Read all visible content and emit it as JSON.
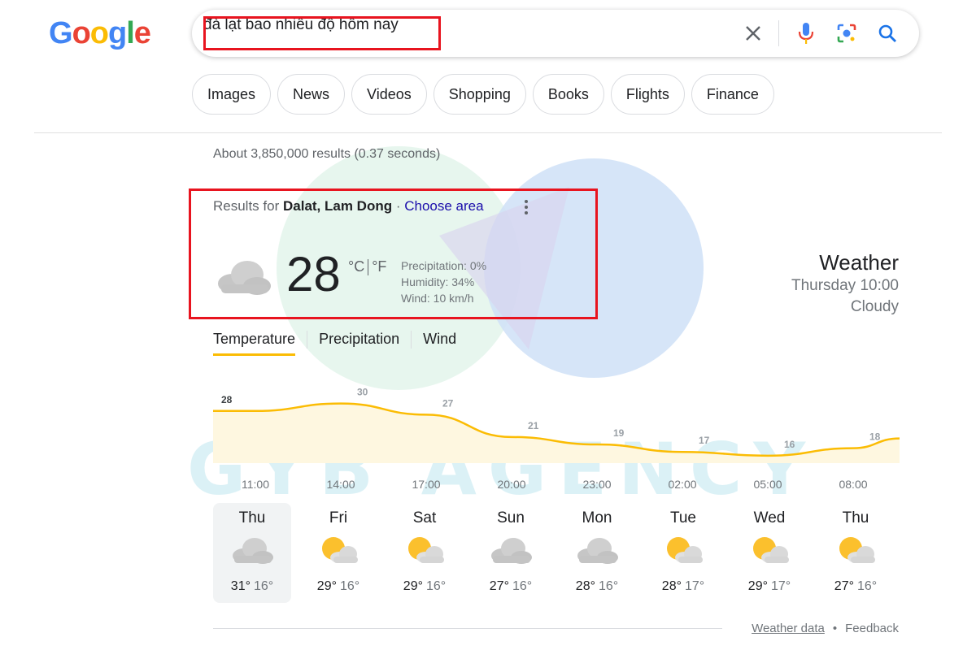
{
  "logo": {
    "text": "Google",
    "colors": [
      "#4285F4",
      "#EA4335",
      "#FBBC05",
      "#4285F4",
      "#34A853",
      "#EA4335"
    ]
  },
  "search": {
    "query": "đà lạt bao nhiêu độ hôm nay",
    "icons": [
      "close-icon",
      "mic-icon",
      "lens-icon",
      "search-icon"
    ]
  },
  "chips": [
    "Images",
    "News",
    "Videos",
    "Shopping",
    "Books",
    "Flights",
    "Finance"
  ],
  "stats": "About 3,850,000 results (0.37 seconds)",
  "location": {
    "prefix": "Results for ",
    "place": "Dalat, Lam Dong",
    "separator": " · ",
    "change": "Choose area"
  },
  "current": {
    "temp": "28",
    "unit_c": "°C",
    "unit_f": "°F",
    "precipitation": "Precipitation: 0%",
    "humidity": "Humidity: 34%",
    "wind": "Wind: 10 km/h",
    "title": "Weather",
    "time": "Thursday 10:00",
    "condition": "Cloudy"
  },
  "tabs": [
    "Temperature",
    "Precipitation",
    "Wind"
  ],
  "chart_data": {
    "type": "area",
    "x": [
      "11:00",
      "14:00",
      "17:00",
      "20:00",
      "23:00",
      "02:00",
      "05:00",
      "08:00"
    ],
    "values": [
      28,
      30,
      27,
      21,
      19,
      17,
      16,
      18
    ],
    "labels": [
      "28",
      "30",
      "27",
      "21",
      "19",
      "17",
      "16",
      "18"
    ],
    "color": "#fbbc04",
    "fill": "#fef7e0"
  },
  "forecast": [
    {
      "day": "Thu",
      "high": "31°",
      "low": "16°",
      "icon": "cloud-icon"
    },
    {
      "day": "Fri",
      "high": "29°",
      "low": "16°",
      "icon": "partly-sunny-icon"
    },
    {
      "day": "Sat",
      "high": "29°",
      "low": "16°",
      "icon": "partly-sunny-icon"
    },
    {
      "day": "Sun",
      "high": "27°",
      "low": "16°",
      "icon": "cloud-icon"
    },
    {
      "day": "Mon",
      "high": "28°",
      "low": "16°",
      "icon": "cloud-icon"
    },
    {
      "day": "Tue",
      "high": "28°",
      "low": "17°",
      "icon": "partly-sunny-icon"
    },
    {
      "day": "Wed",
      "high": "29°",
      "low": "17°",
      "icon": "partly-sunny-icon"
    },
    {
      "day": "Thu",
      "high": "27°",
      "low": "16°",
      "icon": "partly-sunny-icon"
    }
  ],
  "footer": {
    "weather_data": "Weather data",
    "dot": "•",
    "feedback": "Feedback"
  },
  "watermark": {
    "text": "GYB AGENCY"
  }
}
